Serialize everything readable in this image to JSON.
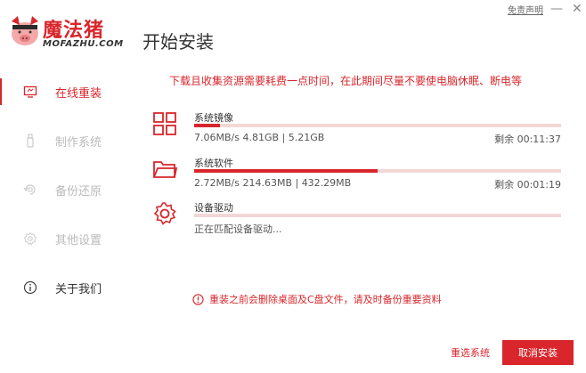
{
  "brand": {
    "logo_text": "魔法猪",
    "logo_sub": "MOFAZHU.COM"
  },
  "header": {
    "title": "开始安装",
    "disclaimer": "免责声明",
    "minimize_glyph": "—",
    "close_glyph": "✕"
  },
  "sidebar": {
    "items": [
      {
        "label": "在线重装",
        "icon": "monitor-icon",
        "state": "active"
      },
      {
        "label": "制作系统",
        "icon": "usb-icon",
        "state": "disabled"
      },
      {
        "label": "备份还原",
        "icon": "backup-icon",
        "state": "disabled"
      },
      {
        "label": "其他设置",
        "icon": "gear-icon",
        "state": "disabled"
      },
      {
        "label": "关于我们",
        "icon": "info-icon",
        "state": "normal"
      }
    ]
  },
  "main": {
    "notice": "下载且收集资源需要耗费一点时间，在此期间尽量不要使电脑休眠、断电等",
    "tasks": [
      {
        "name": "系统镜像",
        "status": "7.06MB/s 4.81GB | 5.21GB",
        "remaining": "剩余 00:11:37",
        "progress": 0.07,
        "icon": "windows-icon"
      },
      {
        "name": "系统软件",
        "status": "2.72MB/s 214.63MB | 432.29MB",
        "remaining": "剩余 00:01:19",
        "progress": 0.5,
        "icon": "folder-icon"
      },
      {
        "name": "设备驱动",
        "status": "正在匹配设备驱动...",
        "remaining": "",
        "progress": 0,
        "icon": "gear-icon"
      }
    ],
    "warning": "重装之前会删除桌面及C盘文件，请及时备份重要资料"
  },
  "footer": {
    "reselect_label": "重选系统",
    "cancel_label": "取消安装"
  },
  "colors": {
    "accent": "#d8262c",
    "track": "#f4d6d6"
  }
}
